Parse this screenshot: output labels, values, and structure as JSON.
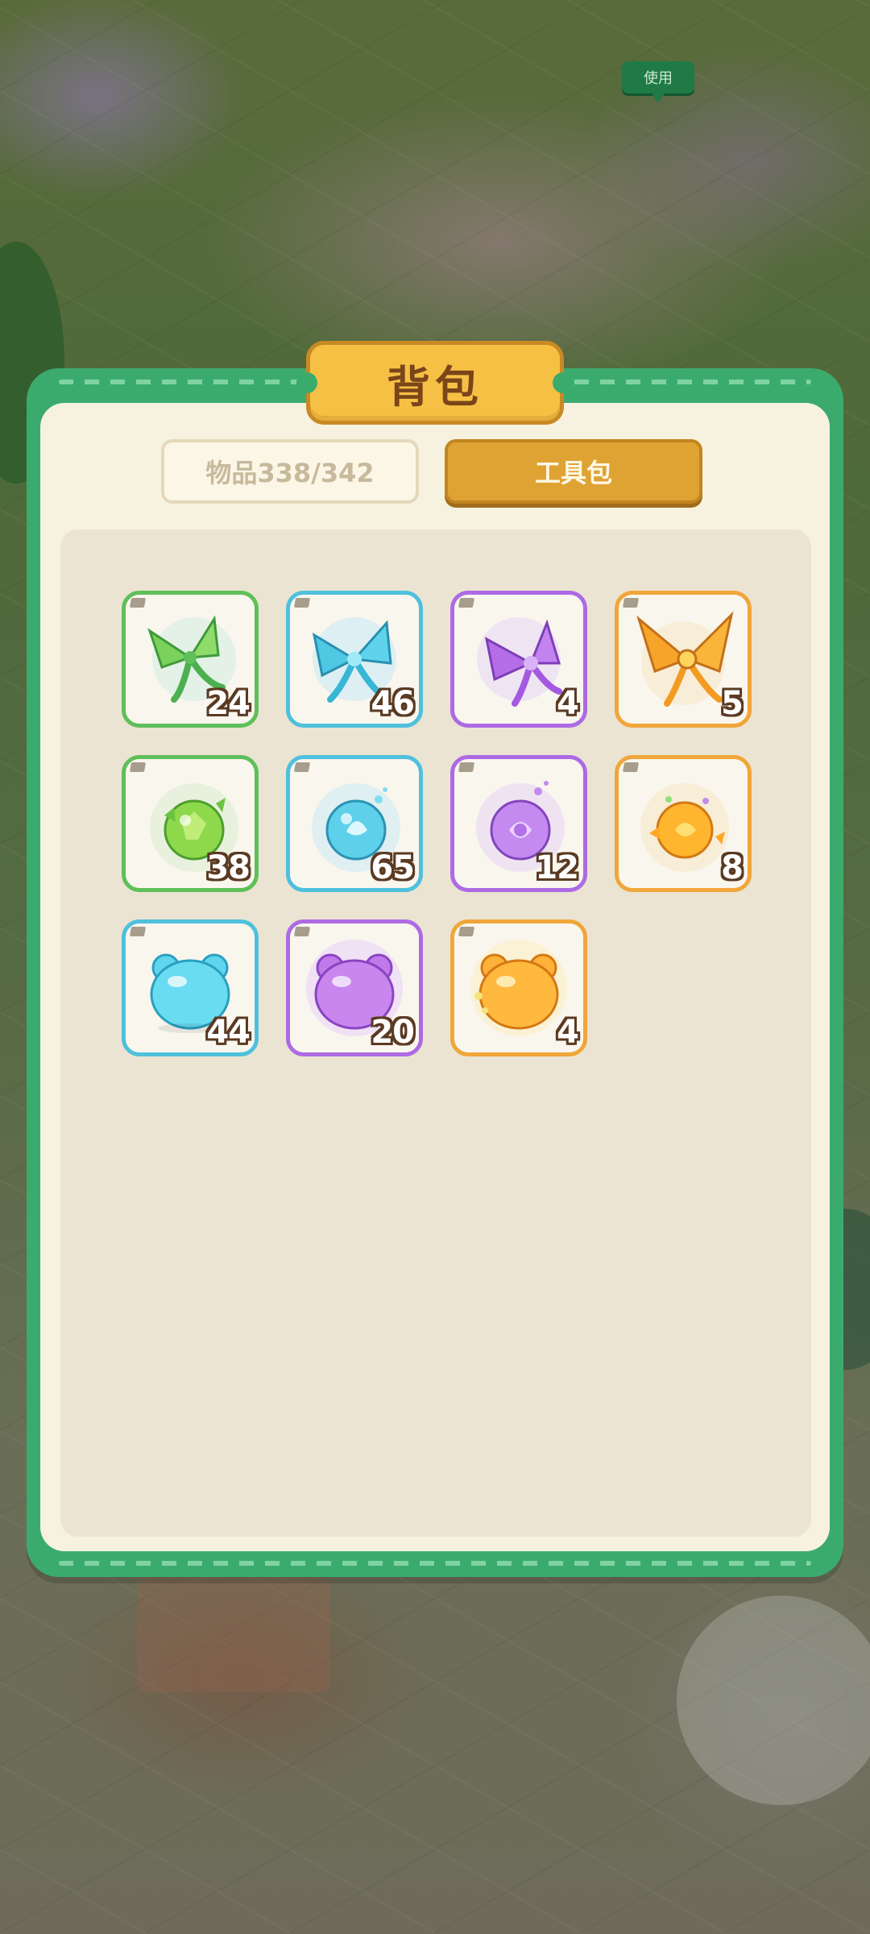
{
  "overlay": {
    "use_tag_label": "使用"
  },
  "panel": {
    "title": "背包",
    "tabs": [
      {
        "label": "物品338/342",
        "active": false
      },
      {
        "label": "工具包",
        "active": true
      }
    ]
  },
  "colors": {
    "frame_green": "#3bab6d",
    "title_gold": "#f6c045",
    "active_tab": "#dfa334",
    "rarity_green": "#5fbf5a",
    "rarity_blue": "#4fc0dd",
    "rarity_purple": "#ad6ae4",
    "rarity_orange": "#f0a63a"
  },
  "items": [
    {
      "icon": "green-bow-icon",
      "rarity": "green",
      "count": "24"
    },
    {
      "icon": "blue-bow-icon",
      "rarity": "blue",
      "count": "46"
    },
    {
      "icon": "purple-bow-icon",
      "rarity": "purple",
      "count": "4"
    },
    {
      "icon": "golden-bow-icon",
      "rarity": "orange",
      "count": "5"
    },
    {
      "icon": "green-orb-icon",
      "rarity": "green",
      "count": "38"
    },
    {
      "icon": "blue-orb-icon",
      "rarity": "blue",
      "count": "65"
    },
    {
      "icon": "purple-orb-icon",
      "rarity": "purple",
      "count": "12"
    },
    {
      "icon": "golden-orb-icon",
      "rarity": "orange",
      "count": "8"
    },
    {
      "icon": "blue-jelly-bear-icon",
      "rarity": "blue",
      "count": "44"
    },
    {
      "icon": "purple-jelly-bear-icon",
      "rarity": "purple",
      "count": "20"
    },
    {
      "icon": "orange-jelly-bear-icon",
      "rarity": "orange",
      "count": "4"
    }
  ]
}
